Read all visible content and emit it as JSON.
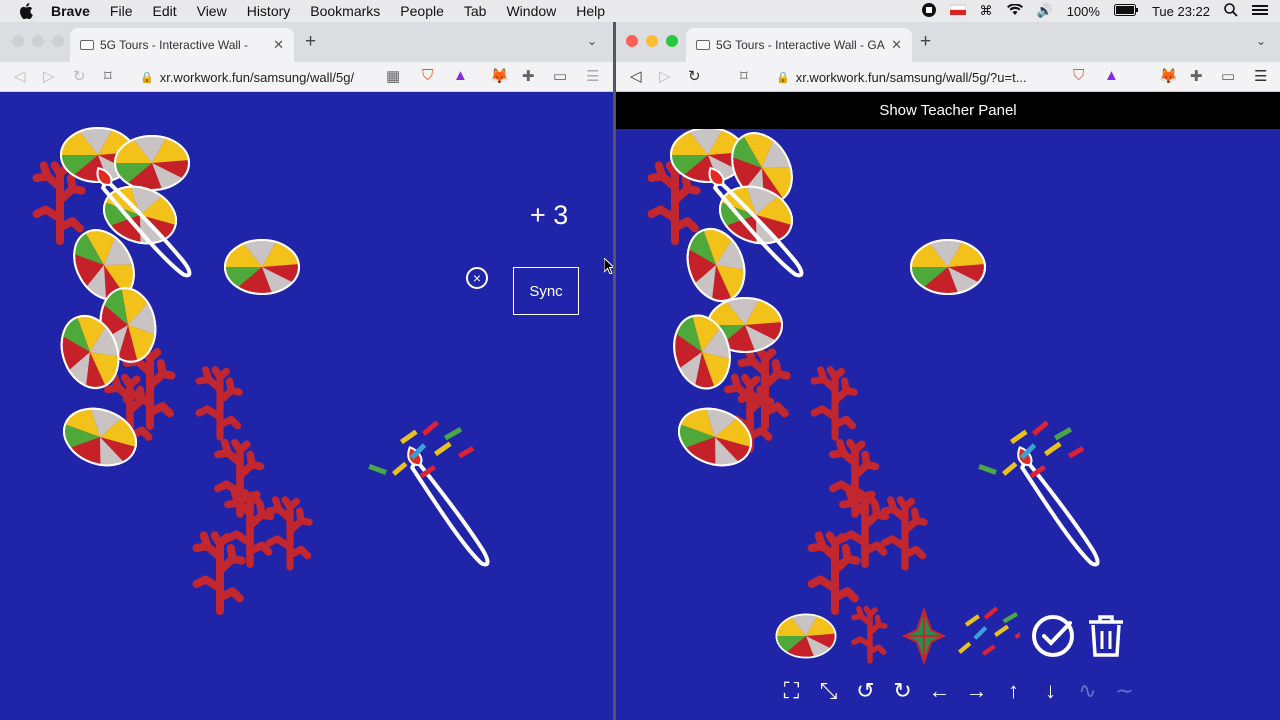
{
  "menubar": {
    "app": "Brave",
    "items": [
      "File",
      "Edit",
      "View",
      "History",
      "Bookmarks",
      "People",
      "Tab",
      "Window",
      "Help"
    ],
    "battery": "100%",
    "clock": "Tue 23:22"
  },
  "left_window": {
    "tab_title": "5G Tours - Interactive Wall -",
    "url": "xr.workwork.fun/samsung/wall/5g/",
    "score": "+ 3",
    "close_symbol": "×",
    "sync_label": "Sync"
  },
  "right_window": {
    "tab_title": "5G Tours - Interactive Wall - GA",
    "url": "xr.workwork.fun/samsung/wall/5g/?u=t...",
    "teacher_panel": "Show Teacher Panel",
    "tools": [
      "pie-disc-tool",
      "coral-tool",
      "compass-star-tool",
      "confetti-tool",
      "check-tool",
      "trash-tool"
    ],
    "nav_icons": [
      "fullscreen-icon",
      "exit-fullscreen-icon",
      "rotate-left-icon",
      "rotate-right-icon",
      "arrow-left-icon",
      "arrow-right-icon",
      "arrow-up-icon",
      "arrow-down-icon",
      "pulse-icon",
      "pulse-small-icon"
    ]
  },
  "colors": {
    "canvas": "#1f24a8",
    "coral": "#c2262e",
    "pie_red": "#c62128",
    "pie_yellow": "#f2c21a",
    "pie_green": "#4ea83a",
    "pie_grey": "#c9c3c3"
  }
}
